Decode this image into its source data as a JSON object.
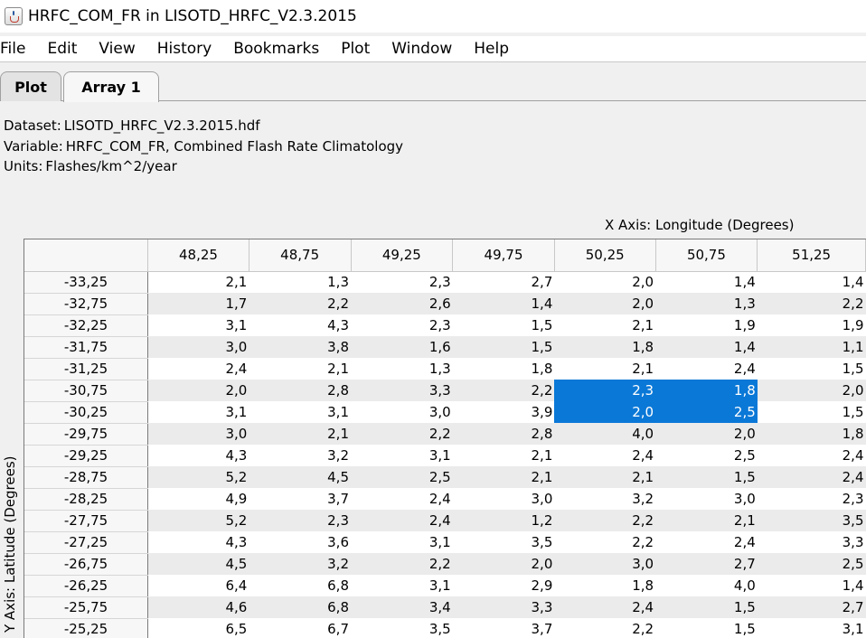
{
  "window": {
    "title": "HRFC_COM_FR in LISOTD_HRFC_V2.3.2015",
    "icon": "java-cup-icon"
  },
  "menu": [
    "File",
    "Edit",
    "View",
    "History",
    "Bookmarks",
    "Plot",
    "Window",
    "Help"
  ],
  "tabs": [
    {
      "label": "Plot",
      "active": false
    },
    {
      "label": "Array 1",
      "active": true
    }
  ],
  "info": {
    "dataset_label": "Dataset:",
    "dataset_value": "LISOTD_HRFC_V2.3.2015.hdf",
    "variable_label": "Variable:",
    "variable_value": "HRFC_COM_FR, Combined Flash Rate Climatology",
    "units_label": "Units:",
    "units_value": "Flashes/km^2/year"
  },
  "axes": {
    "x_label": "X Axis: Longitude (Degrees)",
    "y_label": "Y Axis: Latitude (Degrees)"
  },
  "colors": {
    "selection": "#0a78d7",
    "row_alt": "#ebebeb"
  },
  "table": {
    "columns": [
      "48,25",
      "48,75",
      "49,25",
      "49,75",
      "50,25",
      "50,75",
      "51,25"
    ],
    "rows": [
      {
        "lat": "-33,25",
        "values": [
          "2,1",
          "1,3",
          "2,3",
          "2,7",
          "2,0",
          "1,4",
          "1,4"
        ]
      },
      {
        "lat": "-32,75",
        "values": [
          "1,7",
          "2,2",
          "2,6",
          "1,4",
          "2,0",
          "1,3",
          "2,2"
        ]
      },
      {
        "lat": "-32,25",
        "values": [
          "3,1",
          "4,3",
          "2,3",
          "1,5",
          "2,1",
          "1,9",
          "1,9"
        ]
      },
      {
        "lat": "-31,75",
        "values": [
          "3,0",
          "3,8",
          "1,6",
          "1,5",
          "1,8",
          "1,4",
          "1,1"
        ]
      },
      {
        "lat": "-31,25",
        "values": [
          "2,4",
          "2,1",
          "1,3",
          "1,8",
          "2,1",
          "2,4",
          "1,5"
        ]
      },
      {
        "lat": "-30,75",
        "values": [
          "2,0",
          "2,8",
          "3,3",
          "2,2",
          "2,3",
          "1,8",
          "2,0"
        ]
      },
      {
        "lat": "-30,25",
        "values": [
          "3,1",
          "3,1",
          "3,0",
          "3,9",
          "2,0",
          "2,5",
          "1,5"
        ]
      },
      {
        "lat": "-29,75",
        "values": [
          "3,0",
          "2,1",
          "2,2",
          "2,8",
          "4,0",
          "2,0",
          "1,8"
        ]
      },
      {
        "lat": "-29,25",
        "values": [
          "4,3",
          "3,2",
          "3,1",
          "2,1",
          "2,4",
          "2,5",
          "2,4"
        ]
      },
      {
        "lat": "-28,75",
        "values": [
          "5,2",
          "4,5",
          "2,5",
          "2,1",
          "2,1",
          "1,5",
          "2,4"
        ]
      },
      {
        "lat": "-28,25",
        "values": [
          "4,9",
          "3,7",
          "2,4",
          "3,0",
          "3,2",
          "3,0",
          "2,3"
        ]
      },
      {
        "lat": "-27,75",
        "values": [
          "5,2",
          "2,3",
          "2,4",
          "1,2",
          "2,2",
          "2,1",
          "3,5"
        ]
      },
      {
        "lat": "-27,25",
        "values": [
          "4,3",
          "3,6",
          "3,1",
          "3,5",
          "2,2",
          "2,4",
          "3,3"
        ]
      },
      {
        "lat": "-26,75",
        "values": [
          "4,5",
          "3,2",
          "2,2",
          "2,0",
          "3,0",
          "2,7",
          "2,5"
        ]
      },
      {
        "lat": "-26,25",
        "values": [
          "6,4",
          "6,8",
          "3,1",
          "2,9",
          "1,8",
          "4,0",
          "1,4"
        ]
      },
      {
        "lat": "-25,75",
        "values": [
          "4,6",
          "6,8",
          "3,4",
          "3,3",
          "2,4",
          "1,5",
          "2,7"
        ]
      },
      {
        "lat": "-25,25",
        "values": [
          "6,5",
          "6,7",
          "3,5",
          "3,7",
          "2,2",
          "1,5",
          "3,1"
        ]
      }
    ],
    "selection": {
      "row_start": 5,
      "row_end": 6,
      "col_start": 4,
      "col_end": 5
    }
  }
}
